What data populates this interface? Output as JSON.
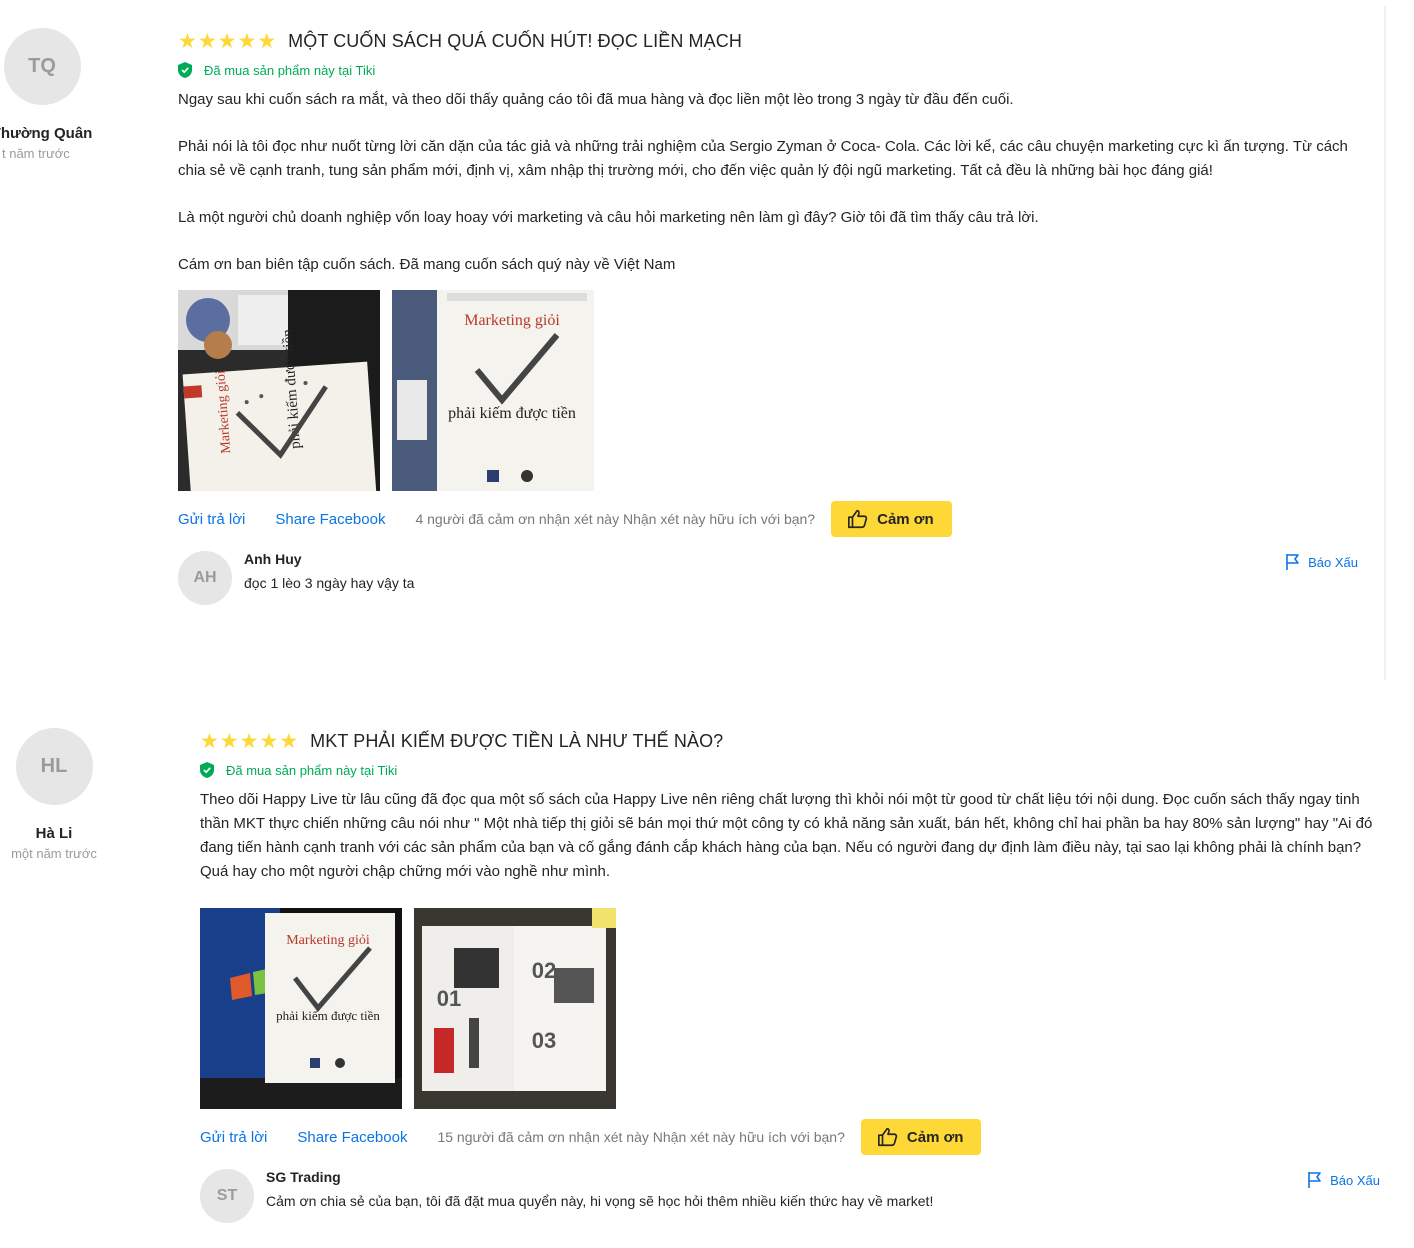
{
  "colors": {
    "accent": "#0b74e5",
    "star": "#fdd836",
    "verified": "#00ab56",
    "button": "#fdd836"
  },
  "reviews": [
    {
      "author": {
        "initials": "TQ",
        "name": "Thường Quân",
        "time": "t năm trước"
      },
      "rating": 5,
      "title": "MỘT CUỐN SÁCH QUÁ CUỐN HÚT! ĐỌC LIỀN MẠCH",
      "verified": "Đã mua sản phẩm này tại Tiki",
      "paragraphs": [
        "Ngay sau khi cuốn sách ra mắt, và theo dõi thấy quảng cáo tôi đã mua hàng và đọc liền một lèo trong 3 ngày từ đầu đến cuối.",
        "Phải nói là tôi đọc như nuốt từng lời căn dặn của tác giả và những trải nghiệm của Sergio Zyman ở Coca- Cola. Các lời kể, các câu chuyện marketing cực kì ấn tượng. Từ cách chia sẻ về cạnh tranh, tung sản phẩm mới, định vị, xâm nhập thị trường mới, cho đến việc quản lý đội ngũ marketing. Tất cả đều là những bài học đáng giá!",
        "Là một người chủ doanh nghiệp vốn loay hoay với marketing và câu hỏi marketing nên làm gì đây? Giờ tôi đã tìm thấy câu trả lời.",
        "Cám ơn ban biên tập cuốn sách. Đã mang cuốn sách quý này về Việt Nam"
      ],
      "images": [
        {
          "book_title": "Marketing giỏi",
          "book_subtitle": "phải kiếm được tiền"
        },
        {
          "book_title": "Marketing giỏi",
          "book_subtitle": "phải kiếm được tiền"
        }
      ],
      "reply_link": "Gửi trả lời",
      "share_link": "Share Facebook",
      "thanks_text": "4 người đã cảm ơn nhận xét này Nhận xét này hữu ích với bạn?",
      "thank_button": "Cảm ơn",
      "comment": {
        "initials": "AH",
        "name": "Anh Huy",
        "text": "đọc 1 lèo 3 ngày hay vậy ta",
        "report": "Báo Xấu"
      }
    },
    {
      "author": {
        "initials": "HL",
        "name": "Hà Li",
        "time": "một năm trước"
      },
      "rating": 5,
      "title": "MKT PHẢI KIẾM ĐƯỢC TIỀN LÀ NHƯ THẾ NÀO?",
      "verified": "Đã mua sản phẩm này tại Tiki",
      "paragraphs": [
        "Theo dõi Happy Live từ lâu cũng đã đọc qua một số sách của Happy Live nên riêng chất lượng thì khỏi nói một từ good từ chất liệu tới nội dung. Đọc cuốn sách thấy ngay tinh thần MKT thực chiến những câu nói như \" Một nhà tiếp thị giỏi sẽ bán mọi thứ một công ty có khả năng sản xuất, bán hết, không chỉ hai phần ba hay 80% sản lượng\" hay \"Ai đó đang tiến hành cạnh tranh với các sản phẩm của bạn và cố gắng đánh cắp khách hàng của bạn. Nếu có người đang dự định làm điều này, tại sao lại không phải là chính bạn? Quá hay cho một người chập chững mới vào nghề như mình."
      ],
      "images": [
        {
          "book_title": "Marketing giỏi",
          "book_subtitle": "phải kiếm được tiền"
        },
        {
          "page_labels": [
            "02",
            "01",
            "03"
          ]
        }
      ],
      "reply_link": "Gửi trả lời",
      "share_link": "Share Facebook",
      "thanks_text": "15 người đã cảm ơn nhận xét này Nhận xét này hữu ích với bạn?",
      "thank_button": "Cảm ơn",
      "comment": {
        "initials": "ST",
        "name": "SG Trading",
        "text": "Cảm ơn chia sẻ của bạn, tôi đã đặt mua quyển này, hi vọng sẽ học hỏi thêm nhiều kiến thức hay về market!",
        "report": "Báo Xấu"
      }
    }
  ]
}
